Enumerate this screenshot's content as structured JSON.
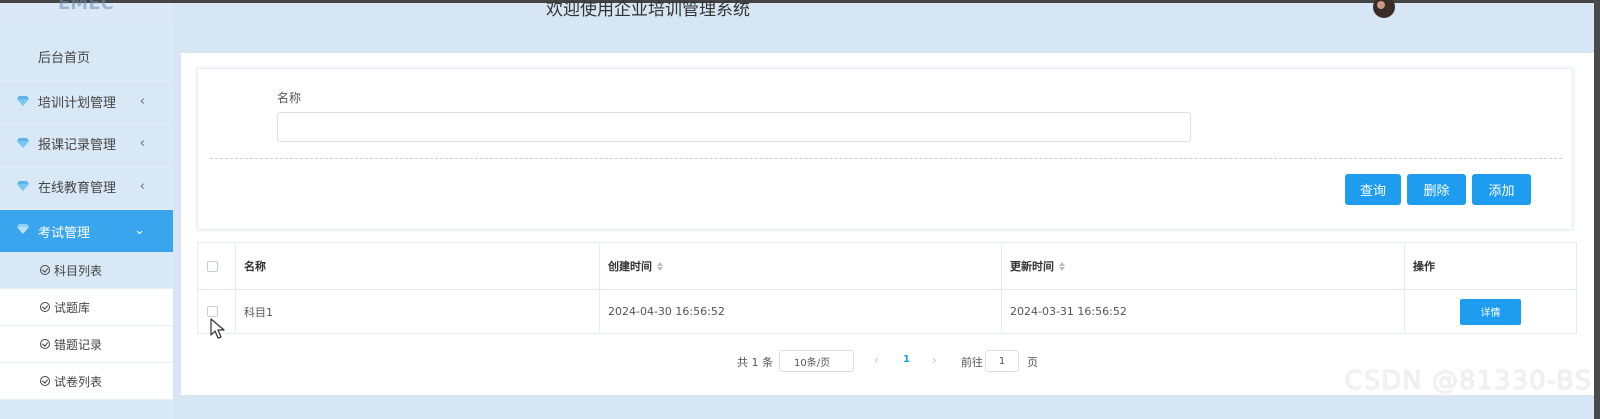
{
  "header": {
    "welcome": "欢迎使用企业培训管理系统"
  },
  "sidebar": {
    "home": "后台首页",
    "groups": [
      {
        "label": "培训计划管理"
      },
      {
        "label": "报课记录管理"
      },
      {
        "label": "在线教育管理"
      },
      {
        "label": "考试管理"
      }
    ],
    "sub_items": [
      {
        "label": "科目列表"
      },
      {
        "label": "试题库"
      },
      {
        "label": "错题记录"
      },
      {
        "label": "试卷列表"
      }
    ],
    "colors": {
      "active_bg": "#3aa5ef"
    }
  },
  "search": {
    "name_label": "名称",
    "name_value": "",
    "buttons": {
      "query": "查询",
      "delete": "删除",
      "add": "添加"
    }
  },
  "table": {
    "headers": {
      "name": "名称",
      "created": "创建时间",
      "updated": "更新时间",
      "actions": "操作"
    },
    "rows": [
      {
        "name": "科目1",
        "created": "2024-04-30 16:56:52",
        "updated": "2024-03-31 16:56:52",
        "action": "详情"
      }
    ]
  },
  "pagination": {
    "total": "共 1 条",
    "page_size": "10条/页",
    "current_page": "1",
    "goto_label": "前往",
    "goto_value": "1",
    "page_suffix": "页"
  },
  "watermark": "CSDN @81330-BS",
  "colors": {
    "primary": "#1d9cf0",
    "background": "#d6e6f5"
  }
}
